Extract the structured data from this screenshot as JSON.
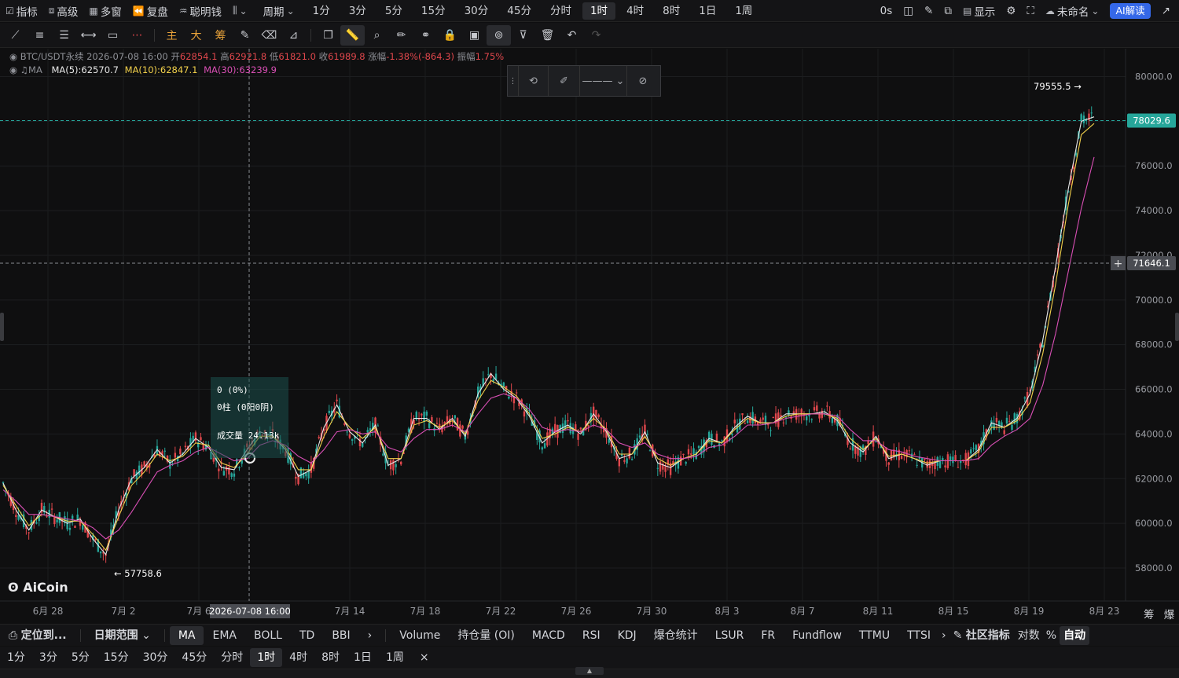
{
  "topbar": {
    "left_items": [
      {
        "icon": "indicator-icon",
        "label": "指标"
      },
      {
        "icon": "window-icon",
        "label": "高级"
      },
      {
        "icon": "grid-icon",
        "label": "多窗"
      },
      {
        "icon": "rewind-icon",
        "label": "复盘"
      },
      {
        "icon": "smart-money-icon",
        "label": "聪明钱"
      },
      {
        "icon": "chart-type-icon",
        "label": ""
      }
    ],
    "period_label": "周期",
    "periods": [
      "1分",
      "3分",
      "5分",
      "15分",
      "30分",
      "45分",
      "分时",
      "1时",
      "4时",
      "8时",
      "1日",
      "1周"
    ],
    "active_period": "1时",
    "timer": "0s",
    "display_label": "显示",
    "cloud_label": "未命名",
    "ai_label": "AI解读"
  },
  "drawing_tools": {
    "text_tools": [
      "主",
      "大",
      "筹"
    ],
    "icons": [
      "line-icon",
      "parallel-line-icon",
      "horizontal-lines-icon",
      "ray-icon",
      "rectangle-icon",
      "more-dots-icon",
      "brush-tool-icon",
      "eraser-tool-icon",
      "measure-tool-icon",
      "copy-icon",
      "ruler-icon",
      "zoom-icon",
      "highlighter-icon",
      "link-icon",
      "lock-icon",
      "snapshot-icon",
      "magnet-icon",
      "filter-icon",
      "trash-icon",
      "undo-icon",
      "redo-icon"
    ]
  },
  "info": {
    "symbol": "BTC/USDT永续",
    "datetime": "2026-07-08 16:00",
    "open_label": "开",
    "open": "62854.1",
    "high_label": "高",
    "high": "62921.8",
    "low_label": "低",
    "low": "61821.0",
    "close_label": "收",
    "close": "61989.8",
    "change_label": "涨幅",
    "change": "-1.38%(-864.3)",
    "amplitude_label": "振幅",
    "amplitude": "1.75%",
    "ma_label": "MA",
    "ma5": "MA(5):62570.7",
    "ma10": "MA(10):62847.1",
    "ma30": "MA(30):63239.9"
  },
  "colors": {
    "up": "#26a69a",
    "down": "#e0474c",
    "ma5": "#e8e8e8",
    "ma10": "#f2d14b",
    "ma30": "#d94fb5",
    "accent": "#3568e8"
  },
  "chart_data": {
    "type": "line",
    "title": "BTC/USDT永续",
    "price_ticks": [
      "80000.0",
      "78000.0",
      "76000.0",
      "74000.0",
      "72000.0",
      "70000.0",
      "68000.0",
      "66000.0",
      "64000.0",
      "62000.0",
      "60000.0",
      "58000.0"
    ],
    "ylim": [
      57000,
      81000
    ],
    "x_ticks": [
      "6月 28",
      "7月 2",
      "7月 6",
      "7月 14",
      "7月 18",
      "7月 22",
      "7月 26",
      "7月 30",
      "8月 3",
      "8月 7",
      "8月 11",
      "8月 15",
      "8月 19",
      "8月 23"
    ],
    "current_price": "78029.6",
    "crosshair_price": "71646.1",
    "crosshair_time": "2026-07-08 16:00",
    "high_marker": "79555.5 →",
    "low_marker": "← 57758.6",
    "series": [
      {
        "name": "MA(5)",
        "values": [
          61800,
          60600,
          59700,
          60600,
          60300,
          60000,
          60200,
          59300,
          58600,
          60600,
          62000,
          62500,
          63300,
          62700,
          63100,
          63800,
          63400,
          62500,
          62400,
          63300,
          64100,
          63900,
          63300,
          62100,
          62400,
          64300,
          65300,
          64100,
          63600,
          64400,
          62600,
          62900,
          64700,
          64700,
          64200,
          64700,
          63900,
          65800,
          66700,
          66000,
          65600,
          64800,
          63600,
          64100,
          64400,
          64000,
          64900,
          64100,
          62900,
          63100,
          64100,
          62700,
          62500,
          62900,
          63100,
          63800,
          63600,
          64300,
          64800,
          64500,
          64500,
          64900,
          64900,
          64900,
          65000,
          64600,
          63600,
          63200,
          63900,
          62900,
          63100,
          62900,
          62600,
          62800,
          62800,
          62800,
          63300,
          64500,
          64300,
          64700,
          65800,
          68200,
          71500,
          75000,
          78000,
          78200
        ]
      },
      {
        "name": "MA(10)",
        "values": [
          61700,
          60800,
          59900,
          60400,
          60300,
          60100,
          60100,
          59500,
          58800,
          60300,
          61700,
          62300,
          63100,
          62800,
          63000,
          63600,
          63500,
          62700,
          62500,
          63100,
          63900,
          63900,
          63400,
          62400,
          62400,
          63900,
          65000,
          64300,
          63800,
          64300,
          62900,
          62900,
          64400,
          64600,
          64300,
          64600,
          64000,
          65500,
          66400,
          66100,
          65700,
          64900,
          63800,
          64000,
          64300,
          64100,
          64700,
          64200,
          63100,
          63100,
          63900,
          62900,
          62600,
          62900,
          63100,
          63700,
          63600,
          64200,
          64700,
          64500,
          64500,
          64800,
          64900,
          64900,
          64900,
          64700,
          63800,
          63300,
          63800,
          63000,
          63100,
          62900,
          62700,
          62800,
          62800,
          62800,
          63200,
          64300,
          64300,
          64600,
          65400,
          67600,
          70700,
          74300,
          77400,
          77900
        ]
      },
      {
        "name": "MA(30)",
        "values": [
          61500,
          61000,
          60400,
          60400,
          60300,
          60200,
          60100,
          59800,
          59300,
          59700,
          60500,
          61400,
          62300,
          62600,
          62800,
          63200,
          63400,
          63100,
          62800,
          62900,
          63500,
          63700,
          63500,
          63000,
          62700,
          63300,
          64100,
          64200,
          64000,
          64100,
          63400,
          63200,
          63800,
          64200,
          64200,
          64400,
          64100,
          64900,
          65600,
          65800,
          65600,
          65100,
          64300,
          64100,
          64200,
          64100,
          64400,
          64200,
          63600,
          63400,
          63600,
          63100,
          62900,
          62900,
          63000,
          63400,
          63500,
          63900,
          64400,
          64400,
          64500,
          64700,
          64800,
          64900,
          64900,
          64800,
          64200,
          63700,
          63700,
          63300,
          63200,
          63000,
          62900,
          62800,
          62800,
          62800,
          62900,
          63500,
          63900,
          64200,
          64700,
          66200,
          68500,
          71300,
          74100,
          76400
        ]
      }
    ]
  },
  "measure_box": {
    "line1": "0 (0%)",
    "line2": "0柱 (0阳0阴)",
    "line3": "成交量 24.13k"
  },
  "logo": "AiCoin",
  "side_labels": [
    "筹",
    "爆"
  ],
  "bottom": {
    "locate": "定位到...",
    "date_range": "日期范围",
    "main_indicators": [
      "MA",
      "EMA",
      "BOLL",
      "TD",
      "BBI"
    ],
    "active_main": "MA",
    "sub_indicators": [
      "Volume",
      "持仓量 (OI)",
      "MACD",
      "RSI",
      "KDJ",
      "爆仓统计",
      "LSUR",
      "FR",
      "Fundflow",
      "TTMU",
      "TTSI"
    ],
    "community": "社区指标",
    "log_label": "对数",
    "pct_label": "%",
    "auto_label": "自动"
  },
  "bottom_periods": [
    "1分",
    "3分",
    "5分",
    "15分",
    "30分",
    "45分",
    "分时",
    "1时",
    "4时",
    "8时",
    "1日",
    "1周"
  ],
  "bottom_active": "1时",
  "close_symbol": "×"
}
